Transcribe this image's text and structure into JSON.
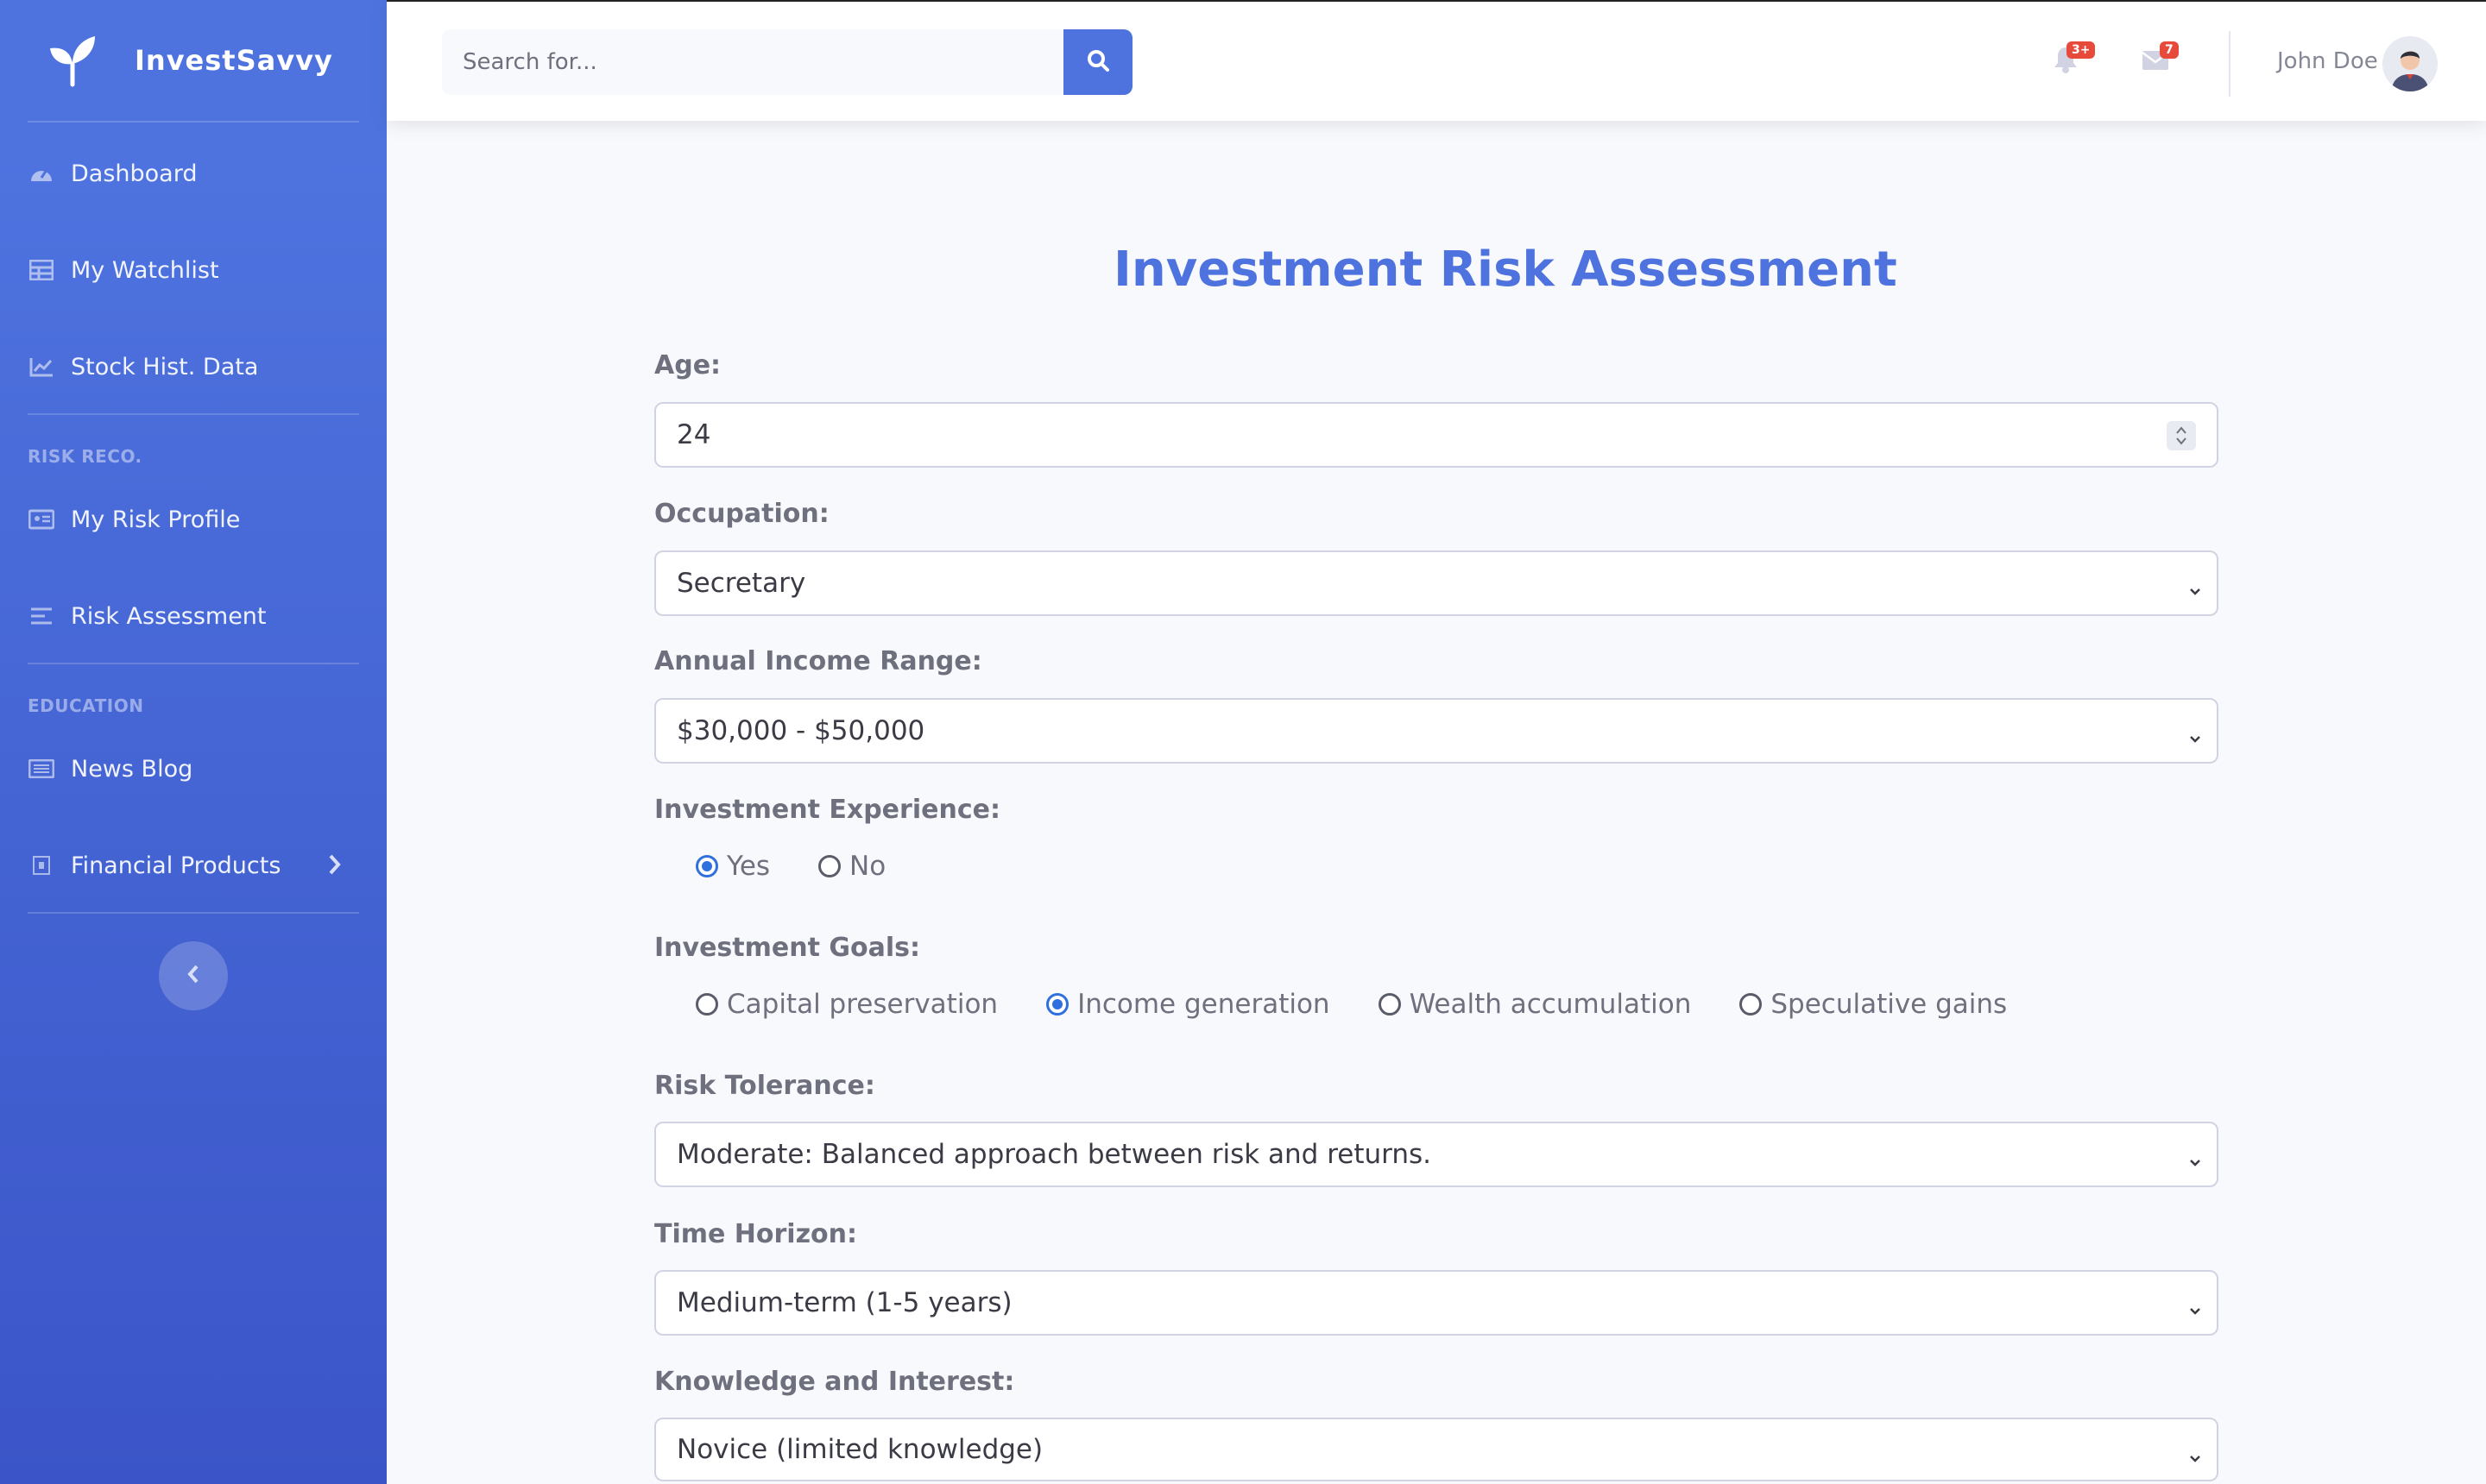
{
  "brand": {
    "name": "InvestSavvy"
  },
  "sidebar": {
    "items": [
      {
        "label": "Dashboard",
        "icon": "dashboard-gauge-icon"
      },
      {
        "label": "My Watchlist",
        "icon": "table-icon"
      },
      {
        "label": "Stock Hist. Data",
        "icon": "chart-line-icon"
      },
      {
        "label": "My Risk Profile",
        "icon": "id-card-icon"
      },
      {
        "label": "Risk Assessment",
        "icon": "align-left-icon"
      },
      {
        "label": "News Blog",
        "icon": "newspaper-icon"
      },
      {
        "label": "Financial Products",
        "icon": "product-icon"
      }
    ],
    "headings": {
      "risk": "RISK RECO.",
      "education": "EDUCATION"
    }
  },
  "search": {
    "placeholder": "Search for..."
  },
  "topbar": {
    "alerts_badge": "3+",
    "messages_badge": "7",
    "user_name": "John Doe"
  },
  "form": {
    "title": "Investment Risk Assessment",
    "age": {
      "label": "Age:",
      "value": "24"
    },
    "occupation": {
      "label": "Occupation:",
      "value": "Secretary"
    },
    "income": {
      "label": "Annual Income Range:",
      "value": "$30,000 - $50,000"
    },
    "experience": {
      "label": "Investment Experience:",
      "options": [
        "Yes",
        "No"
      ],
      "selected": "Yes"
    },
    "goals": {
      "label": "Investment Goals:",
      "options": [
        "Capital preservation",
        "Income generation",
        "Wealth accumulation",
        "Speculative gains"
      ],
      "selected": "Income generation"
    },
    "risk_tolerance": {
      "label": "Risk Tolerance:",
      "value": "Moderate: Balanced approach between risk and returns."
    },
    "time_horizon": {
      "label": "Time Horizon:",
      "value": "Medium-term (1-5 years)"
    },
    "knowledge": {
      "label": "Knowledge and Interest:",
      "value": "Novice (limited knowledge)"
    }
  },
  "colors": {
    "primary": "#4e73df",
    "badge": "#e74a3b",
    "radio_checked": "#2f6fde"
  }
}
